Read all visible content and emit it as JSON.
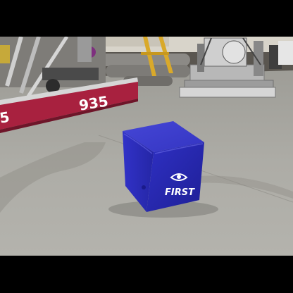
{
  "photo": {
    "robot_left": {
      "bumper_number": "935",
      "bumper_partial": "5"
    },
    "cube": {
      "logo_text": "FIRST"
    }
  },
  "colors": {
    "letterbox": "#000000",
    "floor": "#a9a8a2",
    "bumper": "#a8213f",
    "cube": "#2a2ab8"
  }
}
